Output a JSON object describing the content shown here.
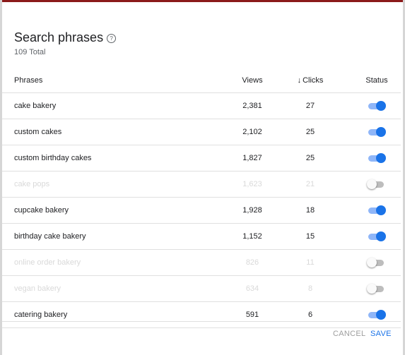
{
  "dialog": {
    "title": "Search phrases",
    "help_icon": "help-circle-icon",
    "help_glyph": "?",
    "subtitle": "109 Total"
  },
  "table": {
    "headers": {
      "phrases": "Phrases",
      "views": "Views",
      "clicks_arrow": "↓",
      "clicks": "Clicks",
      "status": "Status"
    },
    "rows": [
      {
        "phrase": "cake bakery",
        "views": "2,381",
        "clicks": "27",
        "enabled": true
      },
      {
        "phrase": "custom cakes",
        "views": "2,102",
        "clicks": "25",
        "enabled": true
      },
      {
        "phrase": "custom birthday cakes",
        "views": "1,827",
        "clicks": "25",
        "enabled": true
      },
      {
        "phrase": "cake pops",
        "views": "1,623",
        "clicks": "21",
        "enabled": false
      },
      {
        "phrase": "cupcake bakery",
        "views": "1,928",
        "clicks": "18",
        "enabled": true
      },
      {
        "phrase": "birthday cake bakery",
        "views": "1,152",
        "clicks": "15",
        "enabled": true
      },
      {
        "phrase": "online order bakery",
        "views": "826",
        "clicks": "11",
        "enabled": false
      },
      {
        "phrase": "vegan bakery",
        "views": "634",
        "clicks": "8",
        "enabled": false
      },
      {
        "phrase": "catering bakery",
        "views": "591",
        "clicks": "6",
        "enabled": true
      }
    ]
  },
  "footer": {
    "cancel_label": "CANCEL",
    "save_label": "SAVE"
  },
  "colors": {
    "accent": "#1a73e8",
    "toggle_track_on": "#8fb6f8",
    "disabled_text": "#d9d9d9",
    "top_strip": "#8b1a1a"
  }
}
